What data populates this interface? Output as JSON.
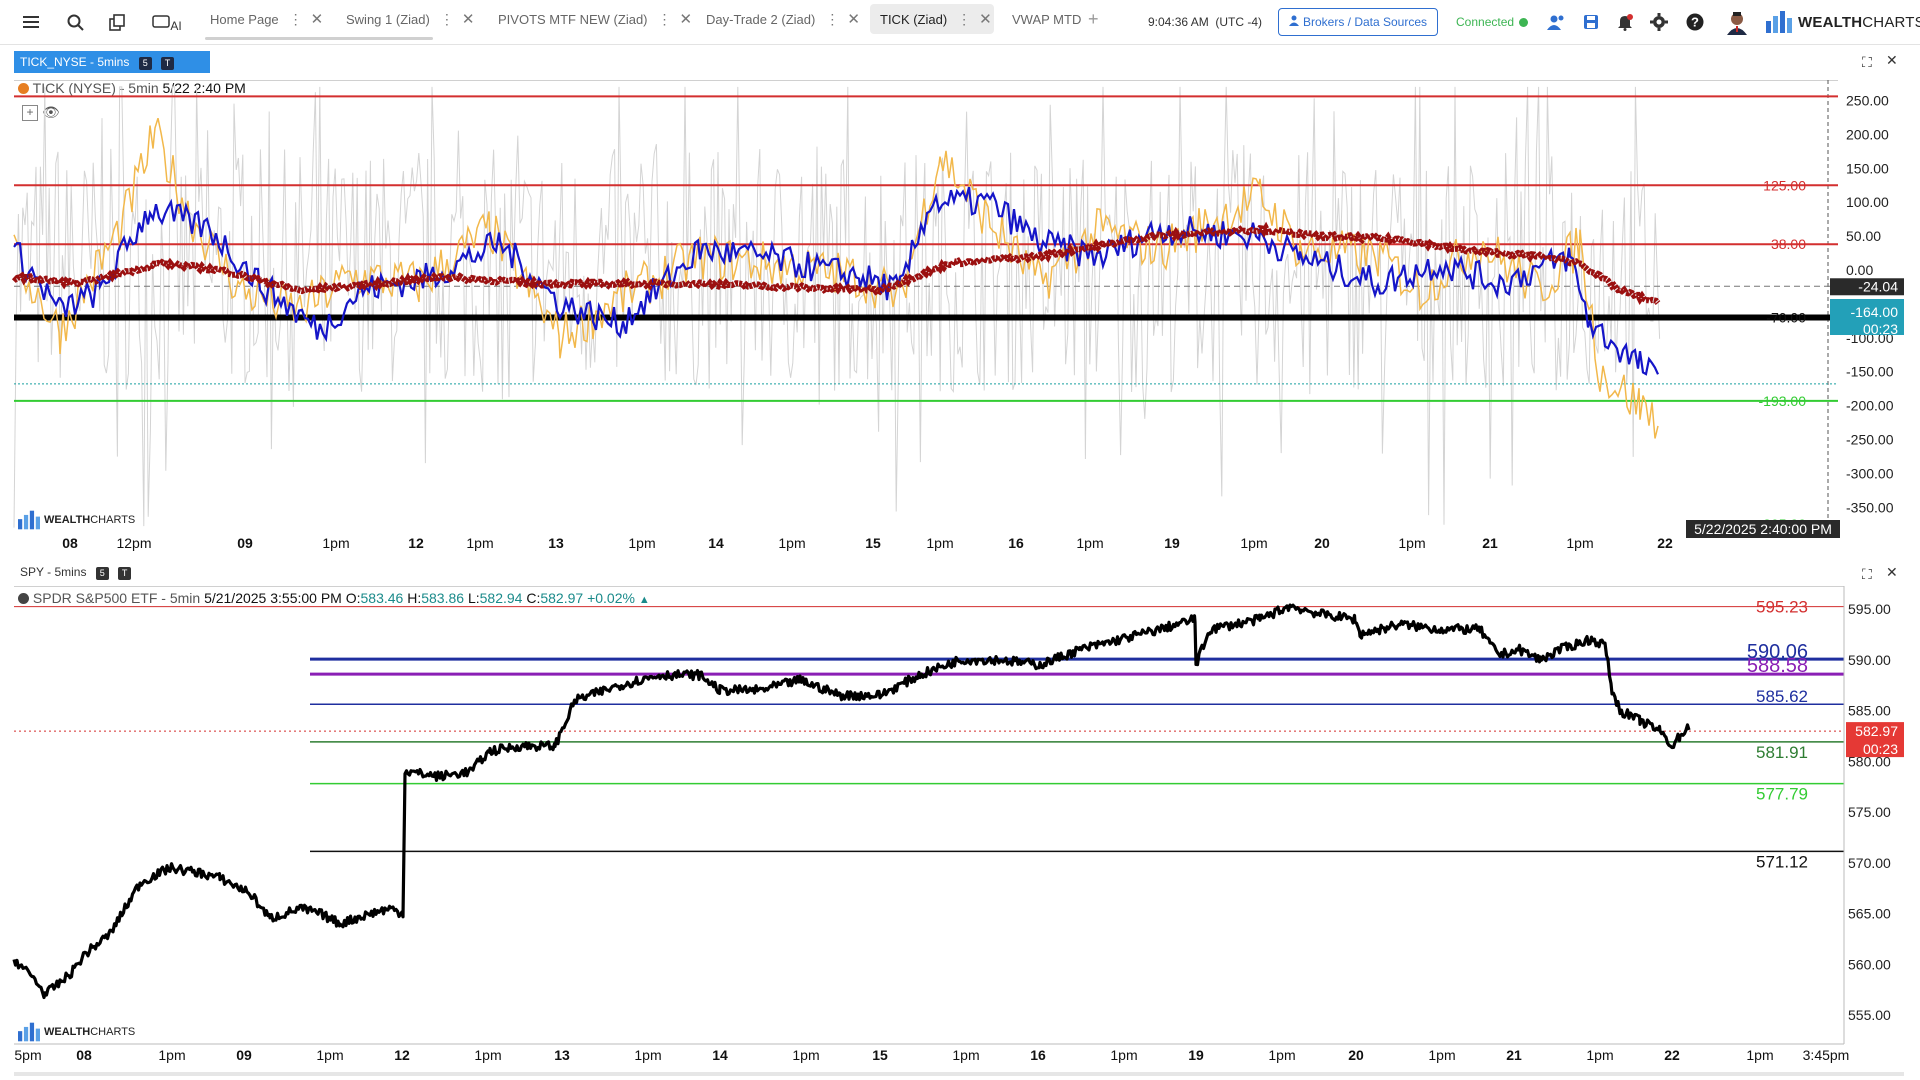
{
  "toolbar": {
    "menu_icon": "hamburger-icon",
    "search_icon": "search-icon",
    "layouts_icon": "copy-icon",
    "ai_label": "AI",
    "tabs": [
      {
        "label": "Home Page",
        "active": false
      },
      {
        "label": "Swing 1 (Ziad)",
        "active": false
      },
      {
        "label": "PIVOTS MTF NEW (Ziad)",
        "active": false
      },
      {
        "label": "Day-Trade 2 (Ziad)",
        "active": false
      },
      {
        "label": "TICK (Ziad)",
        "active": true
      },
      {
        "label": "VWAP MTD",
        "active": false
      }
    ],
    "add_tab": "+",
    "clock": "9:04:36 AM",
    "timezone": "(UTC -4)",
    "brokers_label": "Brokers / Data Sources",
    "connection_status": "Connected",
    "logo_text_bold": "WEALTH",
    "logo_text_light": "CHARTS",
    "colors": {
      "accent": "#2f6fd0",
      "connected": "#3db553"
    }
  },
  "tick_pane": {
    "tab_label": "TICK_NYSE - 5mins",
    "badge_s": "5",
    "badge_t": "T",
    "title": "TICK (NYSE) - 5min",
    "timestamp": "5/22 2:40 PM",
    "watermark_bold": "WEALTH",
    "watermark_light": "CHARTS",
    "y_ticks": [
      "250.00",
      "200.00",
      "150.00",
      "100.00",
      "50.00",
      "0.00",
      "-50.00",
      "-100.00",
      "-150.00",
      "-200.00",
      "-250.00",
      "-300.00",
      "-350.00"
    ],
    "levels": [
      {
        "label": "125.00",
        "color": "#d32f2f"
      },
      {
        "label": "38.00",
        "color": "#d32f2f"
      },
      {
        "label": "-70.00",
        "color": "#111111"
      },
      {
        "label": "-193.00",
        "color": "#33cc33"
      },
      {
        "label": "-395.00",
        "color": "#33cc33"
      }
    ],
    "last_value": "-24.04",
    "blue_value": "-164.00",
    "countdown": "00:23",
    "crosshair_time": "5/22/2025 2:40:00 PM",
    "x_ticks": [
      "08",
      "12pm",
      "09",
      "1pm",
      "12",
      "1pm",
      "13",
      "1pm",
      "14",
      "1pm",
      "15",
      "1pm",
      "16",
      "1pm",
      "19",
      "1pm",
      "20",
      "1pm",
      "21",
      "1pm",
      "22"
    ]
  },
  "spy_pane": {
    "tab_label": "SPY - 5mins",
    "badge_s": "5",
    "badge_t": "T",
    "symbol": "SPDR S&P500 ETF - 5min",
    "timestamp": "5/21/2025 3:55:00 PM",
    "open_label": "O:",
    "open": "583.46",
    "high_label": "H:",
    "high": "583.86",
    "low_label": "L:",
    "low": "582.94",
    "close_label": "C:",
    "close": "582.97",
    "change": "+0.02%",
    "watermark_bold": "WEALTH",
    "watermark_light": "CHARTS",
    "y_ticks": [
      "595.00",
      "590.00",
      "585.00",
      "580.00",
      "575.00",
      "570.00",
      "565.00",
      "560.00",
      "555.00"
    ],
    "levels": [
      {
        "label": "595.23",
        "color": "#d32f2f"
      },
      {
        "label": "590.06",
        "color": "#1f2f9f"
      },
      {
        "label": "588.58",
        "color": "#8a1fb5"
      },
      {
        "label": "585.62",
        "color": "#1f2f9f"
      },
      {
        "label": "581.91",
        "color": "#2e7d32"
      },
      {
        "label": "577.79",
        "color": "#33cc33"
      },
      {
        "label": "571.12",
        "color": "#111111"
      }
    ],
    "last_price": "582.97",
    "countdown": "00:23",
    "x_ticks": [
      "5pm",
      "08",
      "1pm",
      "09",
      "1pm",
      "12",
      "1pm",
      "13",
      "1pm",
      "14",
      "1pm",
      "15",
      "1pm",
      "16",
      "1pm",
      "19",
      "1pm",
      "20",
      "1pm",
      "21",
      "1pm",
      "22",
      "1pm",
      "3:45pm"
    ]
  }
}
